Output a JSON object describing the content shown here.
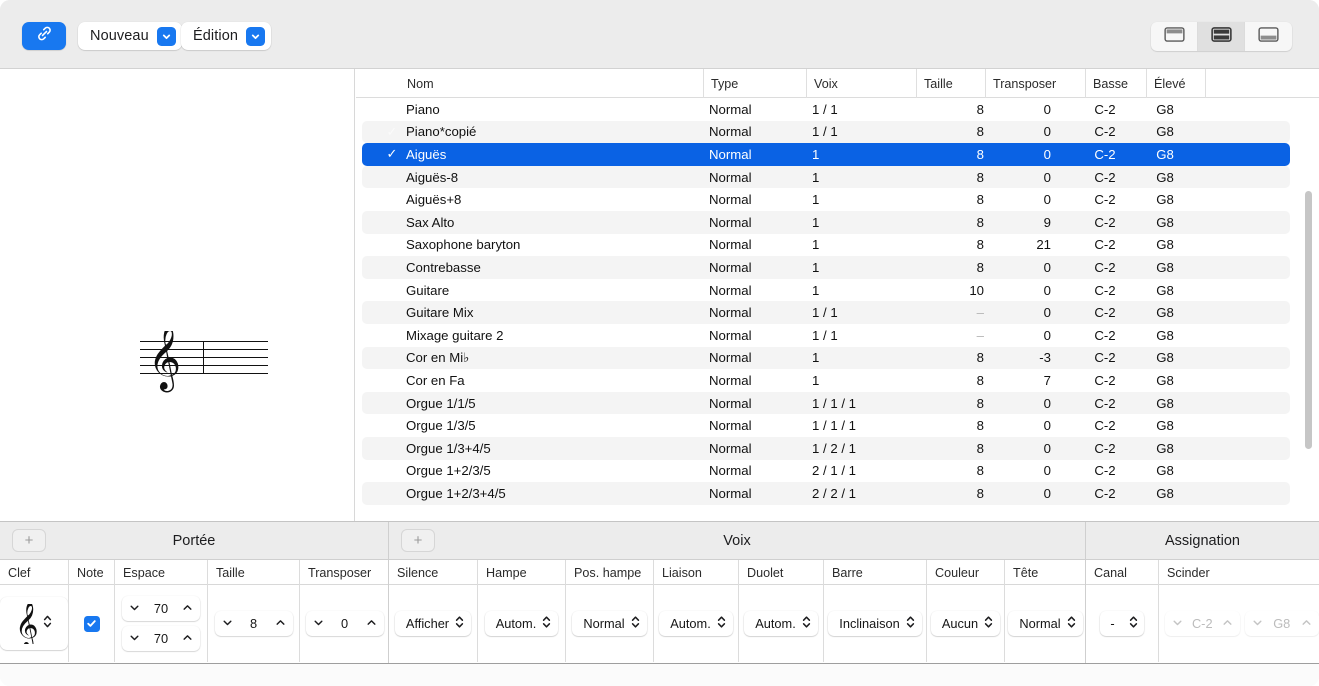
{
  "toolbar": {
    "link_button": "link-icon",
    "nouveau": "Nouveau",
    "edition": "Édition",
    "view_modes": [
      "layout-top-icon",
      "layout-split-icon",
      "layout-bottom-icon"
    ],
    "active_view_mode": 1
  },
  "preview": {
    "clef": "treble-clef",
    "staff_lines": 5
  },
  "table": {
    "columns": [
      "Nom",
      "Type",
      "Voix",
      "Taille",
      "Transposer",
      "Basse",
      "Élevé"
    ],
    "rows": [
      {
        "check": "",
        "nom": "Piano",
        "type": "Normal",
        "voix": "1 / 1",
        "taille": "8",
        "transposer": "0",
        "basse": "C-2",
        "eleve": "G8",
        "selected": false,
        "taille_dim": false
      },
      {
        "check": "✓",
        "nom": "Piano*copié",
        "type": "Normal",
        "voix": "1 / 1",
        "taille": "8",
        "transposer": "0",
        "basse": "C-2",
        "eleve": "G8",
        "selected": false,
        "taille_dim": false
      },
      {
        "check": "✓",
        "nom": "Aiguës",
        "type": "Normal",
        "voix": "1",
        "taille": "8",
        "transposer": "0",
        "basse": "C-2",
        "eleve": "G8",
        "selected": true,
        "taille_dim": false
      },
      {
        "check": "",
        "nom": "Aiguës-8",
        "type": "Normal",
        "voix": "1",
        "taille": "8",
        "transposer": "0",
        "basse": "C-2",
        "eleve": "G8",
        "selected": false,
        "taille_dim": false
      },
      {
        "check": "",
        "nom": "Aiguës+8",
        "type": "Normal",
        "voix": "1",
        "taille": "8",
        "transposer": "0",
        "basse": "C-2",
        "eleve": "G8",
        "selected": false,
        "taille_dim": false
      },
      {
        "check": "",
        "nom": "Sax Alto",
        "type": "Normal",
        "voix": "1",
        "taille": "8",
        "transposer": "9",
        "basse": "C-2",
        "eleve": "G8",
        "selected": false,
        "taille_dim": false
      },
      {
        "check": "",
        "nom": "Saxophone baryton",
        "type": "Normal",
        "voix": "1",
        "taille": "8",
        "transposer": "21",
        "basse": "C-2",
        "eleve": "G8",
        "selected": false,
        "taille_dim": false
      },
      {
        "check": "",
        "nom": "Contrebasse",
        "type": "Normal",
        "voix": "1",
        "taille": "8",
        "transposer": "0",
        "basse": "C-2",
        "eleve": "G8",
        "selected": false,
        "taille_dim": false
      },
      {
        "check": "",
        "nom": "Guitare",
        "type": "Normal",
        "voix": "1",
        "taille": "10",
        "transposer": "0",
        "basse": "C-2",
        "eleve": "G8",
        "selected": false,
        "taille_dim": false
      },
      {
        "check": "",
        "nom": "Guitare Mix",
        "type": "Normal",
        "voix": "1 / 1",
        "taille": "–",
        "transposer": "0",
        "basse": "C-2",
        "eleve": "G8",
        "selected": false,
        "taille_dim": true
      },
      {
        "check": "",
        "nom": "Mixage guitare 2",
        "type": "Normal",
        "voix": "1 / 1",
        "taille": "–",
        "transposer": "0",
        "basse": "C-2",
        "eleve": "G8",
        "selected": false,
        "taille_dim": true
      },
      {
        "check": "",
        "nom": "Cor en Mi♭",
        "type": "Normal",
        "voix": "1",
        "taille": "8",
        "transposer": "-3",
        "basse": "C-2",
        "eleve": "G8",
        "selected": false,
        "taille_dim": false
      },
      {
        "check": "",
        "nom": "Cor en Fa",
        "type": "Normal",
        "voix": "1",
        "taille": "8",
        "transposer": "7",
        "basse": "C-2",
        "eleve": "G8",
        "selected": false,
        "taille_dim": false
      },
      {
        "check": "",
        "nom": "Orgue 1/1/5",
        "type": "Normal",
        "voix": "1 / 1 / 1",
        "taille": "8",
        "transposer": "0",
        "basse": "C-2",
        "eleve": "G8",
        "selected": false,
        "taille_dim": false
      },
      {
        "check": "",
        "nom": "Orgue 1/3/5",
        "type": "Normal",
        "voix": "1 / 1 / 1",
        "taille": "8",
        "transposer": "0",
        "basse": "C-2",
        "eleve": "G8",
        "selected": false,
        "taille_dim": false
      },
      {
        "check": "",
        "nom": "Orgue 1/3+4/5",
        "type": "Normal",
        "voix": "1 / 2 / 1",
        "taille": "8",
        "transposer": "0",
        "basse": "C-2",
        "eleve": "G8",
        "selected": false,
        "taille_dim": false
      },
      {
        "check": "",
        "nom": "Orgue 1+2/3/5",
        "type": "Normal",
        "voix": "2 / 1 / 1",
        "taille": "8",
        "transposer": "0",
        "basse": "C-2",
        "eleve": "G8",
        "selected": false,
        "taille_dim": false
      },
      {
        "check": "",
        "nom": "Orgue 1+2/3+4/5",
        "type": "Normal",
        "voix": "2 / 2 / 1",
        "taille": "8",
        "transposer": "0",
        "basse": "C-2",
        "eleve": "G8",
        "selected": false,
        "taille_dim": false
      }
    ]
  },
  "inspector": {
    "portee": {
      "title": "Portée",
      "add_label": "+",
      "columns": [
        "Clef",
        "Note",
        "Espace",
        "Taille",
        "Transposer"
      ],
      "clef_value": "treble-clef",
      "note_checked": true,
      "espace_top": "70",
      "espace_bottom": "70",
      "taille": "8",
      "transposer": "0"
    },
    "voix": {
      "title": "Voix",
      "add_label": "+",
      "columns": [
        "Silence",
        "Hampe",
        "Pos. hampe",
        "Liaison",
        "Duolet",
        "Barre",
        "Couleur",
        "Tête"
      ],
      "silence": "Afficher",
      "hampe": "Autom.",
      "pos_hampe": "Normal",
      "liaison": "Autom.",
      "duolet": "Autom.",
      "barre": "Inclinaison",
      "couleur": "Aucun",
      "tete": "Normal"
    },
    "assignation": {
      "title": "Assignation",
      "columns": [
        "Canal",
        "Scinder"
      ],
      "canal": "-",
      "scinder_low": "C-2",
      "scinder_high": "G8"
    }
  },
  "colors": {
    "accent": "#1878f0",
    "selection": "#0a62e4",
    "toolbar_bg": "#ececec",
    "row_alt": "#f4f4f4"
  }
}
